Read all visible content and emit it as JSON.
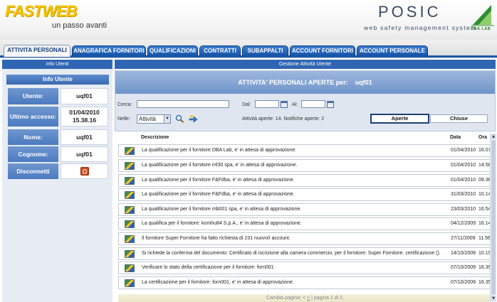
{
  "header": {
    "brand": "FASTWEB",
    "tagline": "un passo avanti",
    "app_title": "POSIC",
    "app_subtitle": "web safety management system",
    "partner_logo": "DBA LAB"
  },
  "tabs": [
    {
      "label": "ATTIVITA PERSONALI",
      "active": true
    },
    {
      "label": "ANAGRAFICA FORNITORI",
      "active": false
    },
    {
      "label": "QUALIFICAZIONI",
      "active": false
    },
    {
      "label": "CONTRATTI",
      "active": false
    },
    {
      "label": "SUBAPPALTI",
      "active": false
    },
    {
      "label": "ACCOUNT FORNITORI",
      "active": false
    },
    {
      "label": "ACCOUNT PERSONALE",
      "active": false
    }
  ],
  "left_panel": {
    "header": "Info Utenti",
    "title": "Info Utente",
    "fields": [
      {
        "label": "Utente:",
        "value": "uqf01"
      },
      {
        "label": "Ultimo accesso:",
        "value": "01/04/2010 15.38.16"
      },
      {
        "label": "Nome:",
        "value": "uqf01"
      },
      {
        "label": "Cognome:",
        "value": "uqf01"
      }
    ],
    "logout_label": "Disconnetti"
  },
  "main": {
    "header": "Gestione Attività Utente",
    "title": "ATTIVITA' PERSONALI APERTE per:",
    "user": "uqf01",
    "filters": {
      "search_label": "Cerca:",
      "search_value": "",
      "from_label": "Dal:",
      "to_label": "Al:",
      "in_label": "Nelle:",
      "in_value": "Attività",
      "summary": "Attività aperte: 14. Notifiche aperte: 2",
      "btn_open": "Aperte",
      "btn_closed": "Chiuse"
    },
    "columns": {
      "description": "Descrizione",
      "date": "Data",
      "time": "Ora"
    },
    "rows": [
      {
        "description": "La qualificazione per il fornitore DBA Lab, e' in attesa di approvazione.",
        "date": "01/04/2010",
        "time": "16.07"
      },
      {
        "description": "La qualificazione per il fornitore mf30 spa, e' in attesa di approvazione.",
        "date": "01/04/2010",
        "time": "14.58"
      },
      {
        "description": "La qualificazione per il fornitore F&Fdba, e' in attesa di approvazione.",
        "date": "01/04/2010",
        "time": "09.36"
      },
      {
        "description": "La qualificazione per il fornitore F&Fdba, e' in attesa di approvazione.",
        "date": "31/03/2010",
        "time": "10.14"
      },
      {
        "description": "La qualificazione per il fornitore mb001 spa, e' in attesa di approvazione.",
        "date": "23/03/2010",
        "time": "16.54"
      },
      {
        "description": "La qualifica per il fornitore: komhu84 S.p.A., e' in attesa di approvazione.",
        "date": "04/12/2009",
        "time": "16.14"
      },
      {
        "description": "Il fornitore Super Fornitore ha fatto richiesta di 231 nuovo/i account.",
        "date": "27/11/2009",
        "time": "11.56"
      },
      {
        "description": "Si richiede la conferma del documento: Certificato di iscrizione alla camera commercio, per il fornitore: Super Fornitore. certificazione ().",
        "date": "14/10/2009",
        "time": "10.19"
      },
      {
        "description": "Verificare lo stato della certificazione per il fornitore: forn001",
        "date": "07/10/2009",
        "time": "16.35"
      },
      {
        "description": "La certificazione per il fornitore: forn001, e' in attesa di approvazione.",
        "date": "07/10/2009",
        "time": "16.35"
      }
    ],
    "pagination": {
      "text": "Cambia pagina: <",
      "next": ">",
      "page_info": "pagina 1 di 2."
    }
  },
  "colors": {
    "accent_blue": "#1b57a8",
    "tab_blue": "#2a66b8",
    "brand_yellow": "#f5c400"
  }
}
